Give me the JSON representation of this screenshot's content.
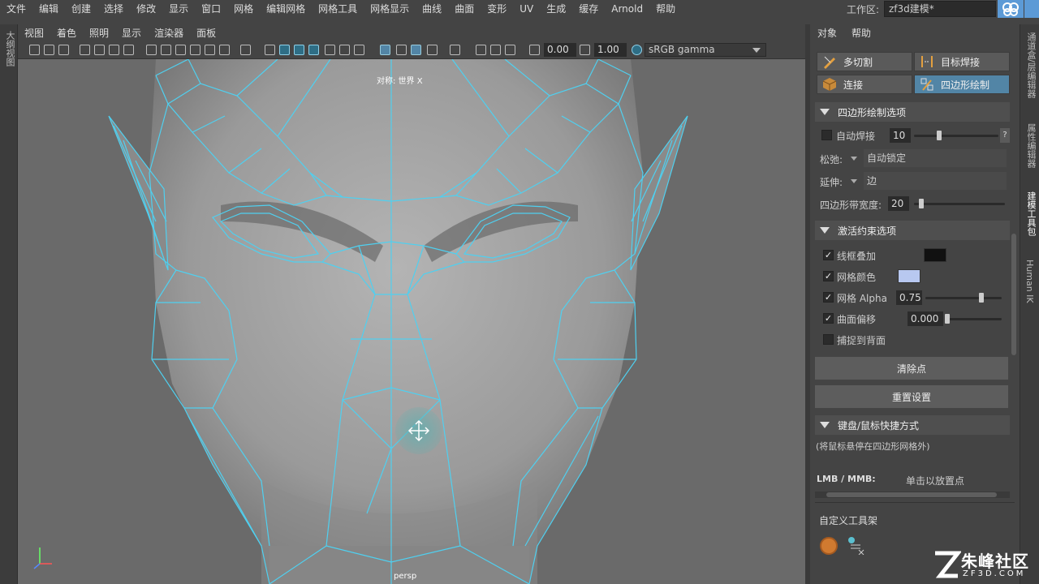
{
  "menu": [
    "文件",
    "编辑",
    "创建",
    "选择",
    "修改",
    "显示",
    "窗口",
    "网格",
    "编辑网格",
    "网格工具",
    "网格显示",
    "曲线",
    "曲面",
    "变形",
    "UV",
    "生成",
    "缓存",
    "Arnold",
    "帮助"
  ],
  "workspace": {
    "label": "工作区:",
    "value": "zf3d建模*"
  },
  "left_strip_label": "大纲视图",
  "panel_menu": [
    "视图",
    "着色",
    "照明",
    "显示",
    "渲染器",
    "面板"
  ],
  "viewport_toolbar": {
    "exposure": "0.00",
    "gamma": "1.00",
    "colorspace": "sRGB gamma"
  },
  "viewport": {
    "symmetry_label": "对称: 世界 X",
    "camera_label": "persp"
  },
  "right_panel": {
    "menu": [
      "对象",
      "帮助"
    ],
    "tools": {
      "multicut": "多切割",
      "target_weld": "目标焊接",
      "connect": "连接",
      "quad_draw": "四边形绘制"
    },
    "quad_section": "四边形绘制选项",
    "auto_weld": {
      "label": "自动焊接",
      "value": "10",
      "help": "?"
    },
    "relax": {
      "label": "松弛:",
      "value": "自动锁定"
    },
    "extend": {
      "label": "延伸:",
      "value": "边"
    },
    "strip_width": {
      "label": "四边形带宽度:",
      "value": "20"
    },
    "constraint_section": "激活约束选项",
    "wire_overlay": {
      "label": "线框叠加",
      "checked": true,
      "color": "#111111"
    },
    "mesh_color": {
      "label": "网格颜色",
      "checked": true,
      "color": "#b8c8f0"
    },
    "mesh_alpha": {
      "label": "网格 Alpha",
      "value": "0.75",
      "checked": true
    },
    "surface_offset": {
      "label": "曲面偏移",
      "value": "0.000",
      "checked": true
    },
    "snap_backface": {
      "label": "捕捉到背面",
      "checked": false
    },
    "clear_btn": "清除点",
    "reset_btn": "重置设置",
    "shortcut_section": "键盘/鼠标快捷方式",
    "shortcut_note": "(将鼠标悬停在四边形网格外)",
    "lmb_label": "LMB / MMB:",
    "lmb_value": "单击以放置点",
    "shelf_label": "自定义工具架"
  },
  "right_tabs": [
    "通道盒/层编辑器",
    "属性编辑器",
    "建模工具包",
    "Human IK"
  ],
  "watermark": {
    "brand": "朱峰社区",
    "site": "ZF3D.COM"
  },
  "colors": {
    "accent": "#5285a6",
    "wire": "#4fd0f0"
  }
}
